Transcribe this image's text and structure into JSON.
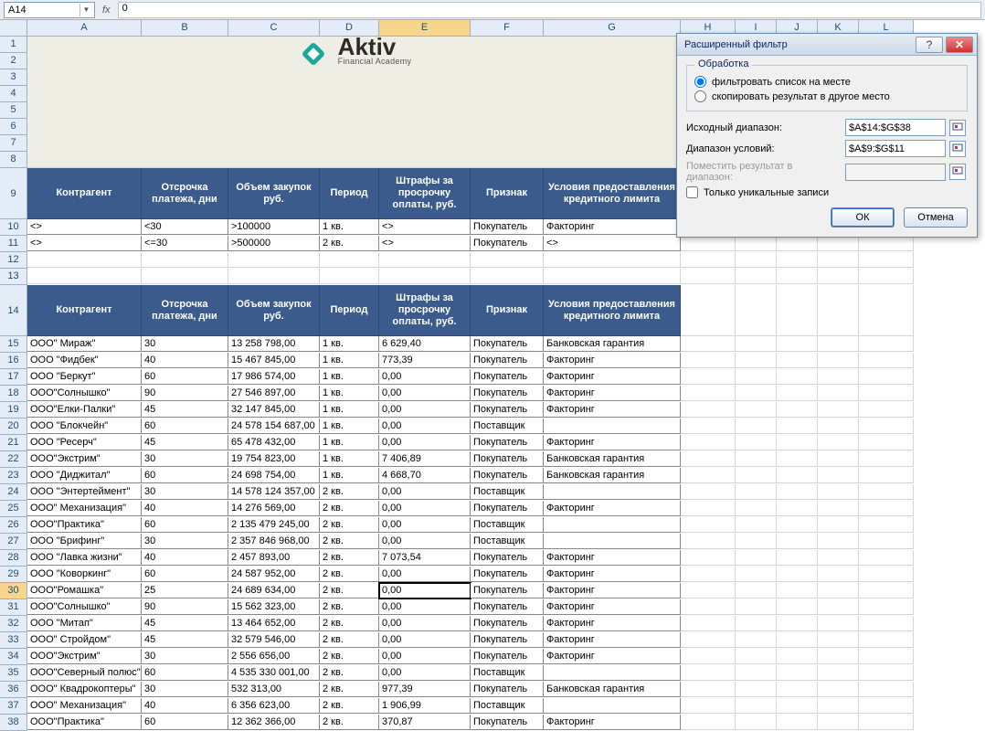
{
  "formula_bar": {
    "name_box": "A14",
    "fx_label": "fx",
    "value": "0"
  },
  "columns": [
    "A",
    "B",
    "C",
    "D",
    "E",
    "F",
    "G",
    "H",
    "I",
    "J",
    "K",
    "L"
  ],
  "active_col": "E",
  "row_headers": [
    1,
    2,
    3,
    4,
    5,
    6,
    7,
    8,
    9,
    10,
    11,
    12,
    13,
    14,
    15,
    16,
    17,
    18,
    19,
    20,
    21,
    22,
    23,
    24,
    25,
    26,
    27,
    28,
    29,
    30,
    31,
    32,
    33,
    34,
    35,
    36,
    37,
    38
  ],
  "active_row": 30,
  "logo": {
    "title": "Aktiv",
    "sub": "Financial Academy"
  },
  "criteria_headers": [
    "Контрагент",
    "Отсрочка платежа, дни",
    "Объем закупок руб.",
    "Период",
    "Штрафы за просрочку оплаты, руб.",
    "Признак",
    "Условия предоставления кредитного лимита"
  ],
  "criteria_rows": [
    [
      "<>",
      "<30",
      ">100000",
      "1 кв.",
      "<>",
      "Покупатель",
      "Факторинг"
    ],
    [
      "<>",
      "<=30",
      ">500000",
      "2 кв.",
      "<>",
      "Покупатель",
      "<>"
    ]
  ],
  "data_headers": [
    "Контрагент",
    "Отсрочка платежа, дни",
    "Объем закупок руб.",
    "Период",
    "Штрафы за просрочку оплаты, руб.",
    "Признак",
    "Условия предоставления кредитного лимита"
  ],
  "data_rows": [
    [
      "ООО\" Мираж\"",
      "30",
      "13 258 798,00",
      "1 кв.",
      "6 629,40",
      "Покупатель",
      "Банковская гарантия"
    ],
    [
      "ООО \"Фидбек\"",
      "40",
      "15 467 845,00",
      "1 кв.",
      "773,39",
      "Покупатель",
      "Факторинг"
    ],
    [
      "ООО \"Беркут\"",
      "60",
      "17 986 574,00",
      "1 кв.",
      "0,00",
      "Покупатель",
      "Факторинг"
    ],
    [
      "ООО\"Солнышко\"",
      "90",
      "27 546 897,00",
      "1 кв.",
      "0,00",
      "Покупатель",
      "Факторинг"
    ],
    [
      "ООО\"Елки-Палки\"",
      "45",
      "32 147 845,00",
      "1 кв.",
      "0,00",
      "Покупатель",
      "Факторинг"
    ],
    [
      "ООО \"Блокчейн\"",
      "60",
      "24 578 154 687,00",
      "1 кв.",
      "0,00",
      "Поставщик",
      ""
    ],
    [
      "ООО \"Ресерч\"",
      "45",
      "65 478 432,00",
      "1 кв.",
      "0,00",
      "Покупатель",
      "Факторинг"
    ],
    [
      "ООО\"Экстрим\"",
      "30",
      "19 754 823,00",
      "1 кв.",
      "7 406,89",
      "Покупатель",
      "Банковская гарантия"
    ],
    [
      "ООО \"Диджитал\"",
      "60",
      "24 698 754,00",
      "1 кв.",
      "4 668,70",
      "Покупатель",
      "Банковская гарантия"
    ],
    [
      "ООО \"Энтертеймент\"",
      "30",
      "14 578 124 357,00",
      "2 кв.",
      "0,00",
      "Поставщик",
      ""
    ],
    [
      "ООО\" Механизация\"",
      "40",
      "14 276 569,00",
      "2 кв.",
      "0,00",
      "Покупатель",
      "Факторинг"
    ],
    [
      "ООО\"Практика\"",
      "60",
      "2 135 479 245,00",
      "2 кв.",
      "0,00",
      "Поставщик",
      ""
    ],
    [
      "ООО \"Брифинг\"",
      "30",
      "2 357 846 968,00",
      "2 кв.",
      "0,00",
      "Поставщик",
      ""
    ],
    [
      "ООО \"Лавка жизни\"",
      "40",
      "2 457 893,00",
      "2 кв.",
      "7 073,54",
      "Покупатель",
      "Факторинг"
    ],
    [
      "ООО \"Коворкинг\"",
      "60",
      "24 587 952,00",
      "2 кв.",
      "0,00",
      "Покупатель",
      "Факторинг"
    ],
    [
      "ООО\"Ромашка\"",
      "25",
      "24 689 634,00",
      "2 кв.",
      "0,00",
      "Покупатель",
      "Факторинг"
    ],
    [
      "ООО\"Солнышко\"",
      "90",
      "15 562 323,00",
      "2 кв.",
      "0,00",
      "Покупатель",
      "Факторинг"
    ],
    [
      "ООО \"Митап\"",
      "45",
      "13 464 652,00",
      "2 кв.",
      "0,00",
      "Покупатель",
      "Факторинг"
    ],
    [
      "ООО\" Стройдом\"",
      "45",
      "32 579 546,00",
      "2 кв.",
      "0,00",
      "Покупатель",
      "Факторинг"
    ],
    [
      "ООО\"Экстрим\"",
      "30",
      "2 556 656,00",
      "2 кв.",
      "0,00",
      "Покупатель",
      "Факторинг"
    ],
    [
      "ООО\"Северный полюс\"",
      "60",
      "4 535 330 001,00",
      "2 кв.",
      "0,00",
      "Поставщик",
      ""
    ],
    [
      "ООО\" Квадрокоптеры\"",
      "30",
      "532 313,00",
      "2 кв.",
      "977,39",
      "Покупатель",
      "Банковская гарантия"
    ],
    [
      "ООО\" Механизация\"",
      "40",
      "6 356 623,00",
      "2 кв.",
      "1 906,99",
      "Поставщик",
      ""
    ],
    [
      "ООО\"Практика\"",
      "60",
      "12 362 366,00",
      "2 кв.",
      "370,87",
      "Покупатель",
      "Факторинг"
    ]
  ],
  "dialog": {
    "title": "Расширенный фильтр",
    "group_label": "Обработка",
    "radio_inplace": "фильтровать список на месте",
    "radio_copy": "скопировать результат в другое место",
    "src_label": "Исходный диапазон:",
    "src_value": "$A$14:$G$38",
    "crit_label": "Диапазон условий:",
    "crit_value": "$A$9:$G$11",
    "dest_label": "Поместить результат в диапазон:",
    "dest_value": "",
    "unique_label": "Только уникальные записи",
    "ok": "ОК",
    "cancel": "Отмена",
    "help": "?",
    "close": "✕"
  }
}
